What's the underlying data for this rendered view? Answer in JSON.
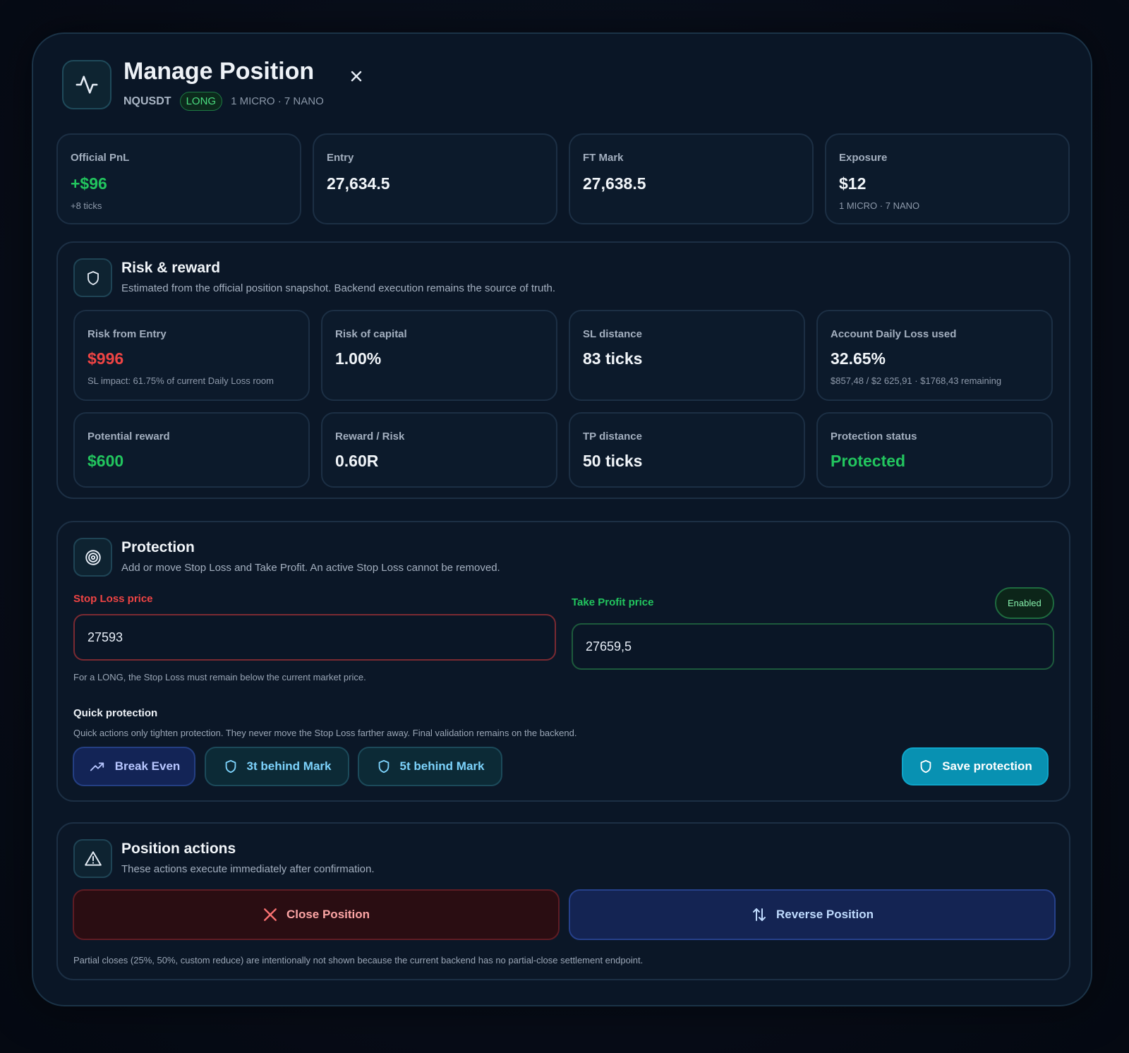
{
  "header": {
    "title": "Manage Position",
    "symbol": "NQUSDT",
    "side": "LONG",
    "size": "1 MICRO · 7 NANO",
    "icon": "activity-icon",
    "close_icon": "close-icon"
  },
  "stats": [
    {
      "label": "Official PnL",
      "value": "+$96",
      "sub": "+8 ticks",
      "tone": "green"
    },
    {
      "label": "Entry",
      "value": "27,634.5",
      "sub": "",
      "tone": "default"
    },
    {
      "label": "FT Mark",
      "value": "27,638.5",
      "sub": "",
      "tone": "default"
    },
    {
      "label": "Exposure",
      "value": "$12",
      "sub": "1 MICRO · 7 NANO",
      "tone": "default"
    }
  ],
  "risk": {
    "title": "Risk & reward",
    "description": "Estimated from the official position snapshot. Backend execution remains the source of truth.",
    "icon": "shield-icon",
    "cards": [
      {
        "label": "Risk from Entry",
        "value": "$996",
        "sub": "SL impact: 61.75% of current Daily Loss room",
        "tone": "red"
      },
      {
        "label": "Risk of capital",
        "value": "1.00%",
        "sub": "",
        "tone": "default"
      },
      {
        "label": "SL distance",
        "value": "83 ticks",
        "sub": "",
        "tone": "default"
      },
      {
        "label": "Account Daily Loss used",
        "value": "32.65%",
        "sub": "$857,48 / $2 625,91 · $1768,43 remaining",
        "tone": "default"
      },
      {
        "label": "Potential reward",
        "value": "$600",
        "sub": "",
        "tone": "green"
      },
      {
        "label": "Reward / Risk",
        "value": "0.60R",
        "sub": "",
        "tone": "default"
      },
      {
        "label": "TP distance",
        "value": "50 ticks",
        "sub": "",
        "tone": "default"
      },
      {
        "label": "Protection status",
        "value": "Protected",
        "sub": "",
        "tone": "green"
      }
    ]
  },
  "protection": {
    "title": "Protection",
    "description": "Add or move Stop Loss and Take Profit. An active Stop Loss cannot be removed.",
    "icon": "target-icon",
    "sl_label": "Stop Loss price",
    "sl_value": "27593",
    "sl_hint": "For a LONG, the Stop Loss must remain below the current market price.",
    "tp_label": "Take Profit price",
    "tp_value": "27659,5",
    "tp_badge": "Enabled",
    "quick_title": "Quick protection",
    "quick_desc": "Quick actions only tighten protection. They never move the Stop Loss farther away. Final validation remains on the backend.",
    "btn_break_even": "Break Even",
    "btn_3t": "3t behind Mark",
    "btn_5t": "5t behind Mark",
    "btn_save": "Save protection"
  },
  "actions": {
    "title": "Position actions",
    "description": "These actions execute immediately after confirmation.",
    "icon": "warning-icon",
    "btn_close": "Close Position",
    "btn_reverse": "Reverse Position",
    "footnote": "Partial closes (25%, 50%, custom reduce) are intentionally not shown because the current backend has no partial-close settlement endpoint."
  },
  "colors": {
    "accent": "#0891b2",
    "positive": "#22c55e",
    "negative": "#ef4444",
    "background": "#0a1626"
  }
}
